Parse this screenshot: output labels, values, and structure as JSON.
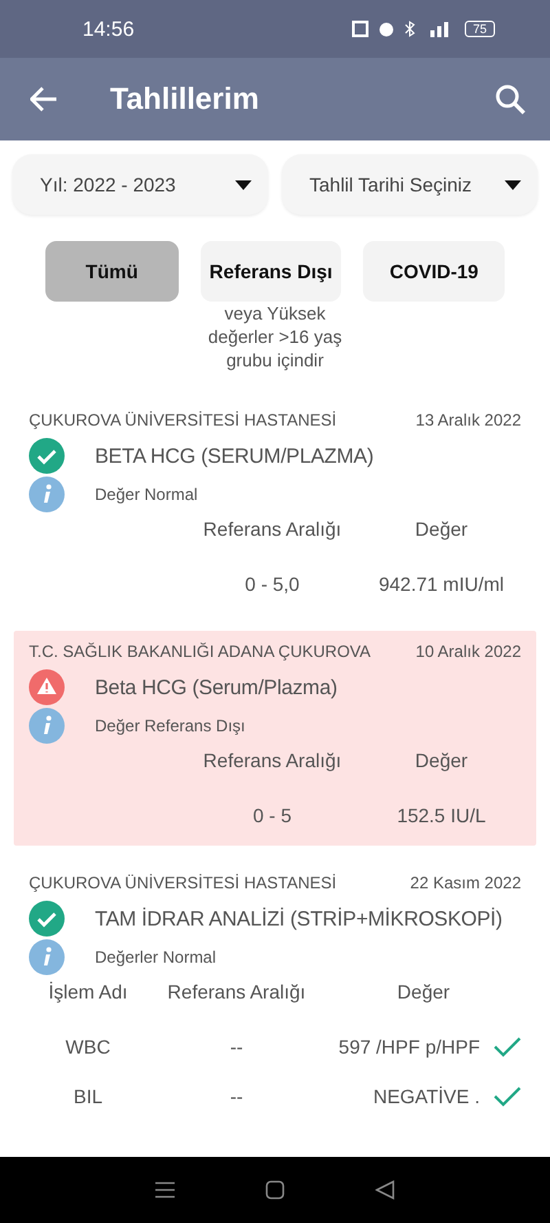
{
  "status_bar": {
    "time": "14:56",
    "battery": "75"
  },
  "app_bar": {
    "title": "Tahlillerim"
  },
  "filters": [
    {
      "label": "Yıl: 2022 - 2023"
    },
    {
      "label": "Tahlil Tarihi Seçiniz"
    }
  ],
  "tabs": [
    {
      "label": "Tümü",
      "selected": true
    },
    {
      "label": "Referans Dışı",
      "selected": false
    },
    {
      "label": "COVID-19",
      "selected": false
    }
  ],
  "note": [
    "veya Yüksek",
    "değerler >16 yaş",
    "grubu içindir"
  ],
  "results": [
    {
      "hospital": "ÇUKUROVA ÜNİVERSİTESİ HASTANESİ",
      "date": "13 Aralık 2022",
      "test": "BETA HCG (SERUM/PLAZMA)",
      "kind": "normal",
      "summary": "Değer Normal",
      "columns": [
        "Referans Aralığı",
        "Değer"
      ],
      "rows": [
        {
          "cells": [
            "0 - 5,0",
            "942.71 mIU/ml"
          ]
        }
      ]
    },
    {
      "hospital": "T.C. SAĞLIK BAKANLIĞI ADANA ÇUKUROVA",
      "date": "10 Aralık 2022",
      "test": "Beta HCG (Serum/Plazma)",
      "kind": "abnormal",
      "summary": "Değer Referans Dışı",
      "columns": [
        "Referans Aralığı",
        "Değer"
      ],
      "rows": [
        {
          "cells": [
            "0 - 5",
            "152.5 IU/L"
          ]
        }
      ]
    },
    {
      "hospital": "ÇUKUROVA ÜNİVERSİTESİ HASTANESİ",
      "date": "22 Kasım 2022",
      "test": "TAM İDRAR ANALİZİ (STRİP+MİKROSKOPİ)",
      "kind": "normal",
      "summary": "Değerler Normal",
      "columns": [
        "İşlem Adı",
        "Referans Aralığı",
        "Değer"
      ],
      "rows": [
        {
          "cells": [
            "WBC",
            "--",
            "597 /HPF  p/HPF"
          ],
          "ok": true
        },
        {
          "cells": [
            "BIL",
            "--",
            "NEGATİVE ."
          ],
          "ok": true
        }
      ]
    }
  ]
}
